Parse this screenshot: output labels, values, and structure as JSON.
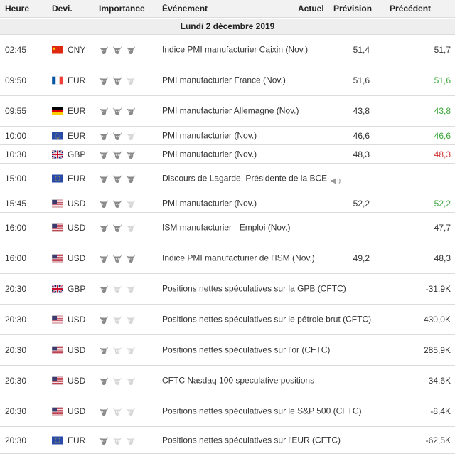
{
  "header": {
    "time": "Heure",
    "currency": "Devi.",
    "importance": "Importance",
    "event": "Événement",
    "actual": "Actuel",
    "forecast": "Prévision",
    "previous": "Précédent"
  },
  "date_label": "Lundi 2 décembre 2019",
  "colors": {
    "better": "#3ba63b",
    "worse": "#d43a3a",
    "bull_active": "#8a8a8a",
    "bull_inactive": "#d8d8d8"
  },
  "events": [
    {
      "time": "02:45",
      "flag": "cn-flag-icon",
      "currency": "CNY",
      "importance": 3,
      "event": "Indice PMI manufacturier Caixin (Nov.)",
      "actual": "",
      "forecast": "51,4",
      "previous": "51,7",
      "previous_status": "neutral"
    },
    {
      "time": "09:50",
      "flag": "fr-flag-icon",
      "currency": "EUR",
      "importance": 2,
      "event": "PMI manufacturier France (Nov.)",
      "actual": "",
      "forecast": "51,6",
      "previous": "51,6",
      "previous_status": "better"
    },
    {
      "time": "09:55",
      "flag": "de-flag-icon",
      "currency": "EUR",
      "importance": 3,
      "event": "PMI manufacturier Allemagne (Nov.)",
      "actual": "",
      "forecast": "43,8",
      "previous": "43,8",
      "previous_status": "better"
    },
    {
      "time": "10:00",
      "flag": "eu-flag-icon",
      "currency": "EUR",
      "importance": 2,
      "event": "PMI manufacturier (Nov.)",
      "actual": "",
      "forecast": "46,6",
      "previous": "46,6",
      "previous_status": "better"
    },
    {
      "time": "10:30",
      "flag": "gb-flag-icon",
      "currency": "GBP",
      "importance": 3,
      "event": "PMI manufacturier (Nov.)",
      "actual": "",
      "forecast": "48,3",
      "previous": "48,3",
      "previous_status": "worse"
    },
    {
      "time": "15:00",
      "flag": "eu-flag-icon",
      "currency": "EUR",
      "importance": 3,
      "event": "Discours de Lagarde, Présidente de la BCE",
      "speech": true,
      "actual": "",
      "forecast": "",
      "previous": "",
      "previous_status": "neutral"
    },
    {
      "time": "15:45",
      "flag": "us-flag-icon",
      "currency": "USD",
      "importance": 2,
      "event": "PMI manufacturier (Nov.)",
      "actual": "",
      "forecast": "52,2",
      "previous": "52,2",
      "previous_status": "better"
    },
    {
      "time": "16:00",
      "flag": "us-flag-icon",
      "currency": "USD",
      "importance": 2,
      "event": "ISM manufacturier - Emploi (Nov.)",
      "actual": "",
      "forecast": "",
      "previous": "47,7",
      "previous_status": "neutral"
    },
    {
      "time": "16:00",
      "flag": "us-flag-icon",
      "currency": "USD",
      "importance": 3,
      "event": "Indice PMI manufacturier de l'ISM (Nov.)",
      "actual": "",
      "forecast": "49,2",
      "previous": "48,3",
      "previous_status": "neutral"
    },
    {
      "time": "20:30",
      "flag": "gb-flag-icon",
      "currency": "GBP",
      "importance": 1,
      "event": "Positions nettes spéculatives sur la GPB (CFTC)",
      "actual": "",
      "forecast": "",
      "previous": "-31,9K",
      "previous_status": "neutral"
    },
    {
      "time": "20:30",
      "flag": "us-flag-icon",
      "currency": "USD",
      "importance": 1,
      "event": "Positions nettes spéculatives sur le pétrole brut (CFTC)",
      "actual": "",
      "forecast": "",
      "previous": "430,0K",
      "previous_status": "neutral"
    },
    {
      "time": "20:30",
      "flag": "us-flag-icon",
      "currency": "USD",
      "importance": 1,
      "event": "Positions nettes spéculatives sur l'or (CFTC)",
      "actual": "",
      "forecast": "",
      "previous": "285,9K",
      "previous_status": "neutral"
    },
    {
      "time": "20:30",
      "flag": "us-flag-icon",
      "currency": "USD",
      "importance": 1,
      "event": "CFTC Nasdaq 100 speculative positions",
      "actual": "",
      "forecast": "",
      "previous": "34,6K",
      "previous_status": "neutral"
    },
    {
      "time": "20:30",
      "flag": "us-flag-icon",
      "currency": "USD",
      "importance": 1,
      "event": "Positions nettes spéculatives sur le S&P 500 (CFTC)",
      "actual": "",
      "forecast": "",
      "previous": "-8,4K",
      "previous_status": "neutral"
    },
    {
      "time": "20:30",
      "flag": "eu-flag-icon",
      "currency": "EUR",
      "importance": 1,
      "event": "Positions nettes spéculatives sur l'EUR (CFTC)",
      "actual": "",
      "forecast": "",
      "previous": "-62,5K",
      "previous_status": "neutral"
    }
  ]
}
